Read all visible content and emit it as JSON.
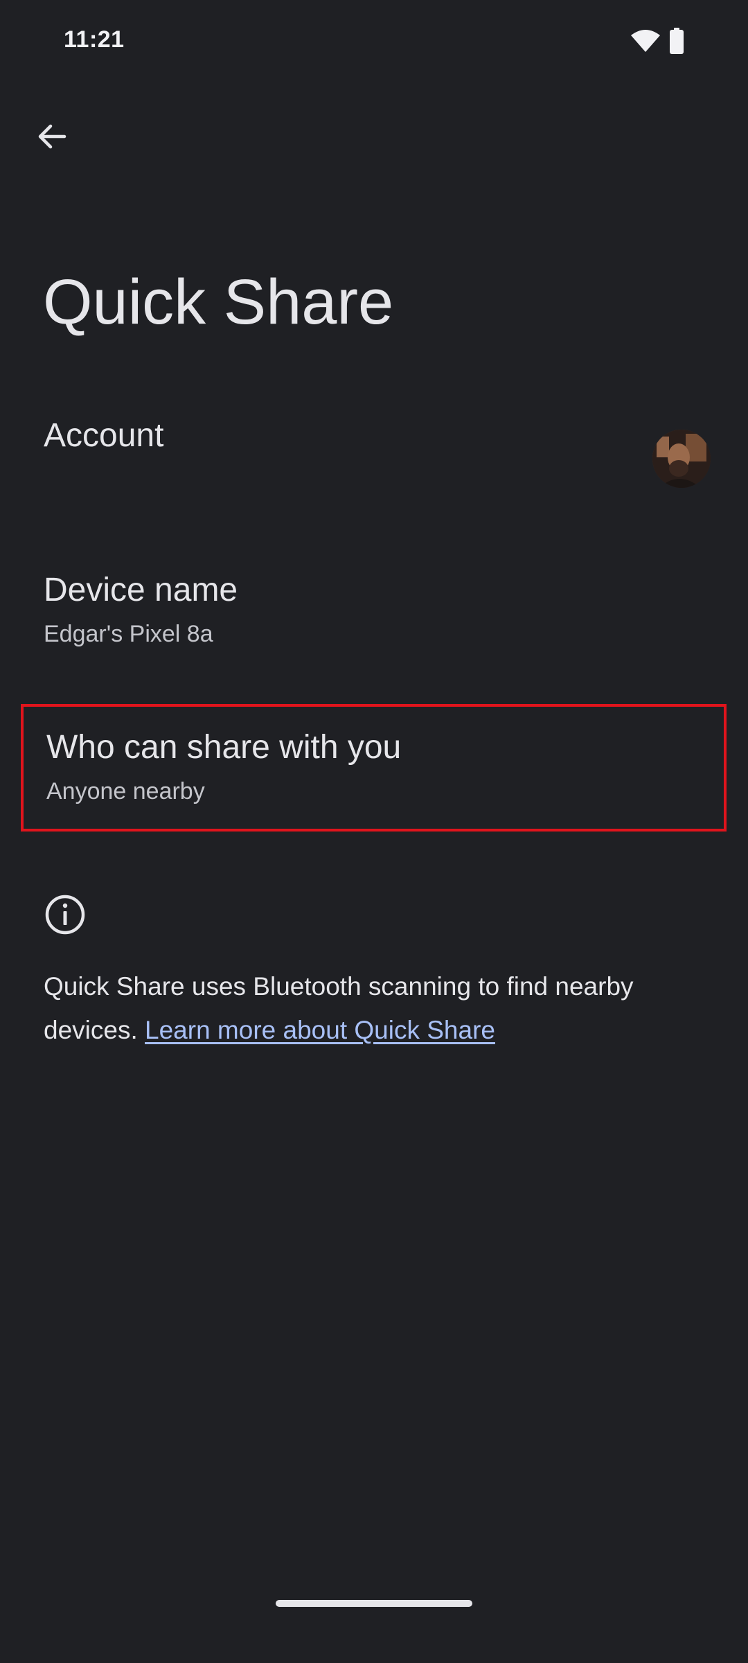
{
  "status_bar": {
    "time": "11:21",
    "icons": [
      "wifi-icon",
      "battery-icon"
    ]
  },
  "header": {
    "back_icon": "arrow-left-icon",
    "title": "Quick Share"
  },
  "settings": {
    "account": {
      "title": "Account",
      "avatar": "avatar"
    },
    "device_name": {
      "title": "Device name",
      "summary": "Edgar's Pixel 8a"
    },
    "who_can_share": {
      "title": "Who can share with you",
      "summary": "Anyone nearby",
      "highlight_color": "#e0141c"
    }
  },
  "info": {
    "icon": "info-icon",
    "text": "Quick Share uses Bluetooth scanning to find nearby devices. ",
    "link_text": "Learn more about Quick Share"
  },
  "colors": {
    "background": "#1f2024",
    "text": "#e6e6ea",
    "link": "#a8c0f6"
  }
}
